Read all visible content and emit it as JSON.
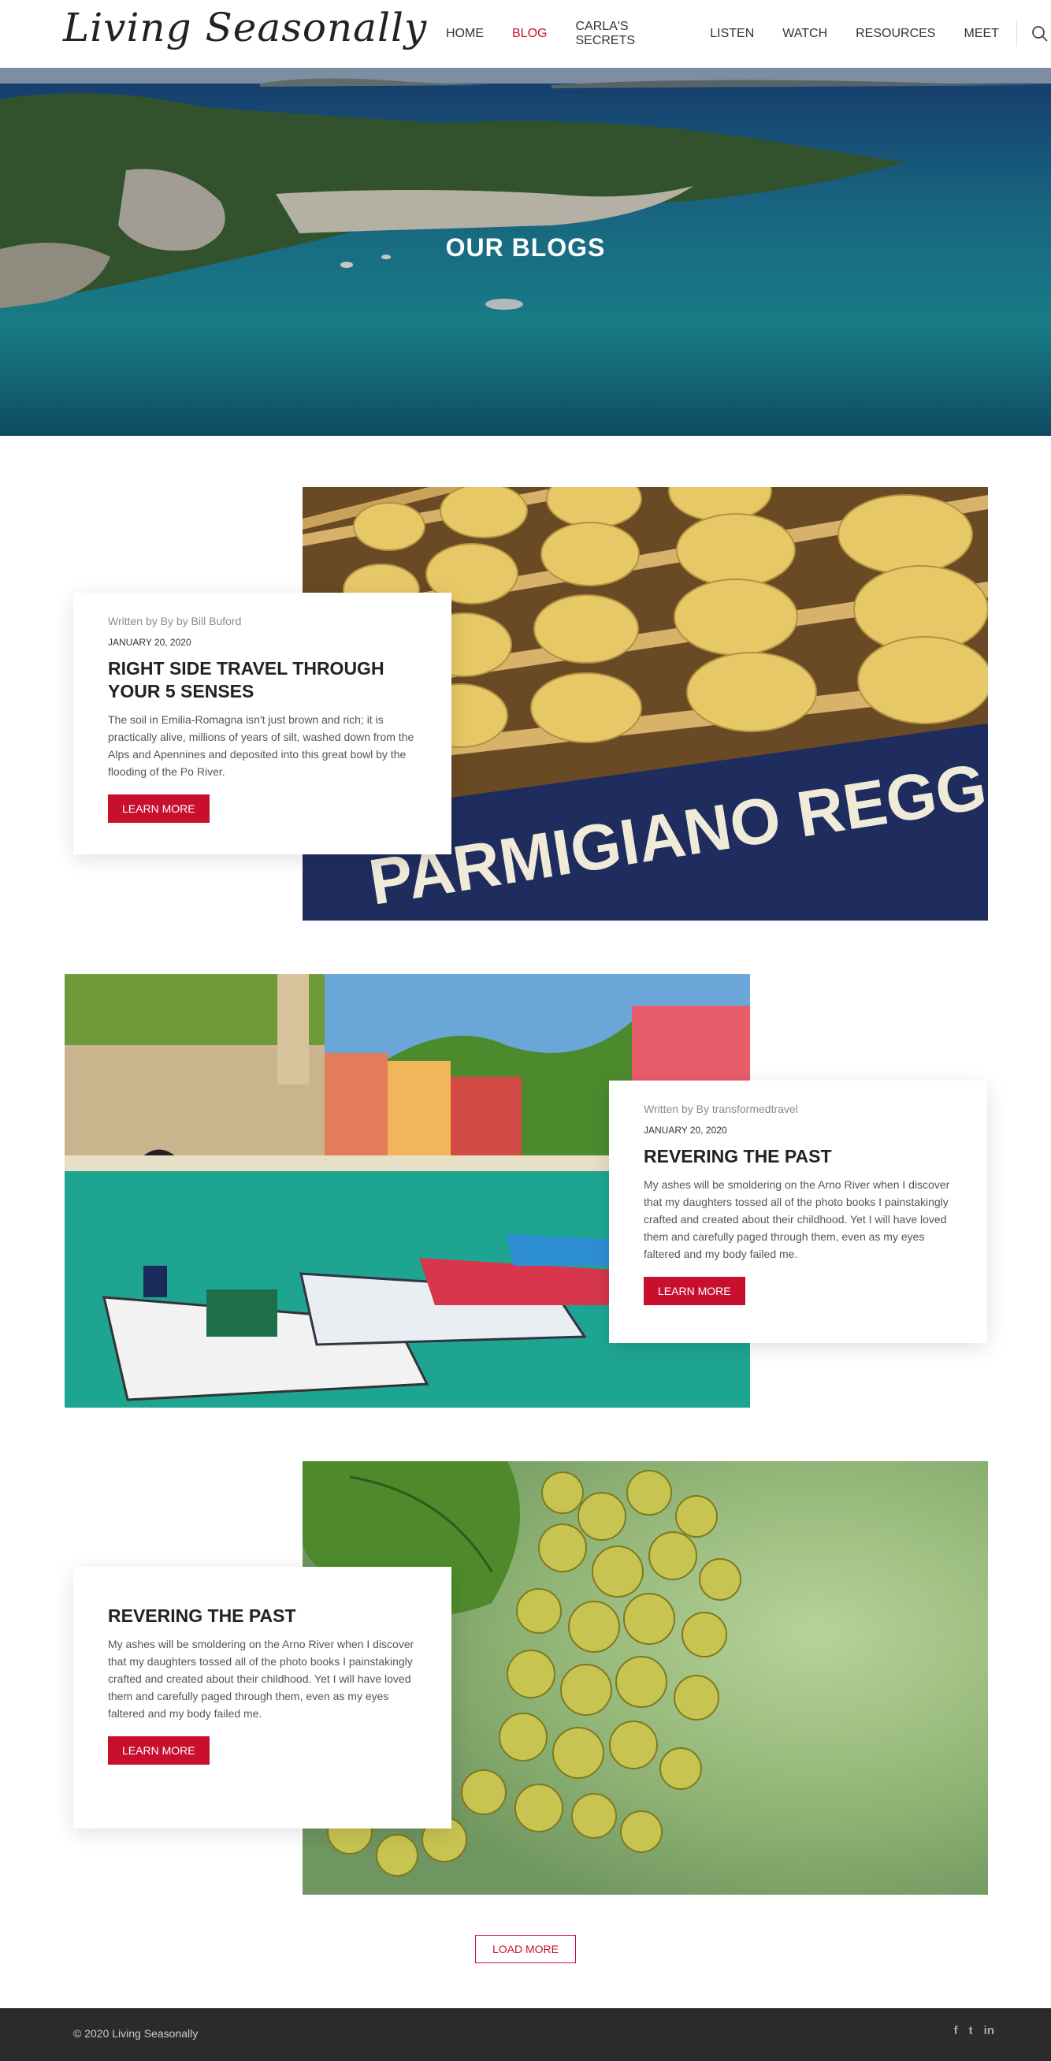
{
  "header": {
    "logo": "Living Seasonally",
    "nav": [
      {
        "label": "HOME",
        "active": false
      },
      {
        "label": "BLOG",
        "active": true
      },
      {
        "label": "CARLA'S SECRETS",
        "active": false
      },
      {
        "label": "LISTEN",
        "active": false
      },
      {
        "label": "WATCH",
        "active": false
      },
      {
        "label": "RESOURCES",
        "active": false
      },
      {
        "label": "MEET",
        "active": false
      }
    ],
    "search_icon": "search-icon"
  },
  "hero": {
    "title": "OUR BLOGS"
  },
  "posts": [
    {
      "byline": "Written by By by Bill Buford",
      "date": "JANUARY 20, 2020",
      "title": "RIGHT SIDE TRAVEL THROUGH YOUR 5 SENSES",
      "excerpt": "The soil in Emilia-Romagna isn't just brown and rich; it is practically alive, millions of years of silt, washed down from the Alps and Apennines and deposited into this great bowl by the flooding of the Po River.",
      "button": "LEARN MORE",
      "image_sign": "PARMIGIANO REGG"
    },
    {
      "byline": "Written by By transformedtravel",
      "date": "JANUARY 20, 2020",
      "title": "REVERING THE PAST",
      "excerpt": "My ashes will be smoldering on the Arno River when I discover that my daughters tossed all of the photo books I painstakingly crafted and created about their childhood. Yet I will have loved them and carefully paged through them, even as my eyes faltered and my body failed me.",
      "button": "LEARN MORE"
    },
    {
      "title": "REVERING THE PAST",
      "excerpt": "My ashes will be smoldering on the Arno River when I discover that my daughters tossed all of the photo books I painstakingly crafted and created about their childhood. Yet I will have loved them and carefully paged through them, even as my eyes faltered and my body failed me.",
      "button": "LEARN MORE"
    }
  ],
  "load_more": "LOAD MORE",
  "footer": {
    "copyright": "© 2020 Living Seasonally",
    "social": [
      {
        "icon": "facebook-icon",
        "glyph": "f"
      },
      {
        "icon": "twitter-icon",
        "glyph": "t"
      },
      {
        "icon": "linkedin-icon",
        "glyph": "in"
      }
    ]
  },
  "colors": {
    "accent": "#c8102e",
    "footer_bg": "#2b2b2b"
  }
}
